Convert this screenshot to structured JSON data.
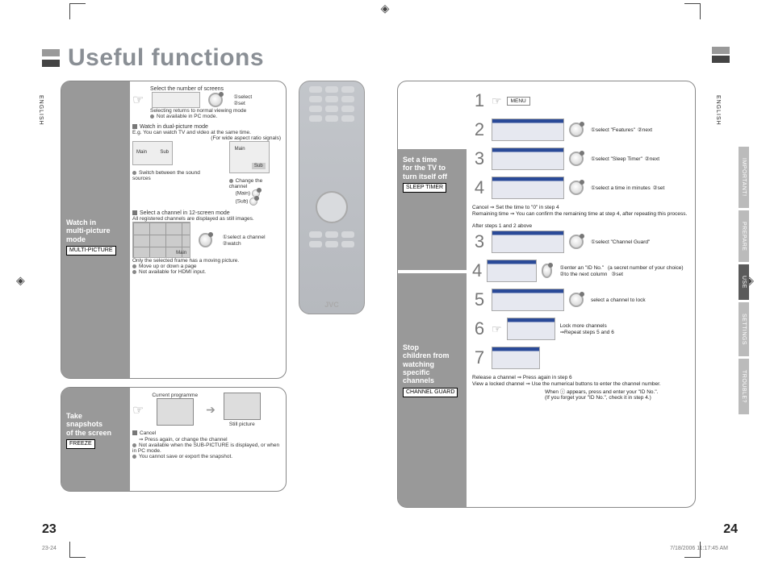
{
  "language_label": "ENGLISH",
  "page_title": "Useful functions",
  "side_tabs": [
    "IMPORTANT!",
    "PREPARE",
    "USE",
    "SETTINGS",
    "TROUBLE?"
  ],
  "side_tabs_active_index": 2,
  "left_page_number": "23",
  "right_page_number": "24",
  "footer_sheet": "23-24",
  "footer_timestamp": "7/18/2006   11:17:45 AM",
  "section_multi_picture": {
    "header_lines": [
      "Watch in",
      "multi-picture",
      "mode"
    ],
    "button_label": "MULTI-PICTURE",
    "select_screens_title": "Select the number of screens",
    "knob1_a": "①select",
    "knob1_b": "②set",
    "selecting_note": "Selecting          returns to normal viewing mode",
    "not_pc": "Not available in PC mode.",
    "dual_title": "Watch in dual-picture mode",
    "dual_eg": "E.g. You can watch TV and video at the same time.",
    "wide_note": "(For wide aspect ratio signals)",
    "box_main": "Main",
    "box_sub": "Sub",
    "switch_title": "Switch between the sound sources",
    "change_title": "Change the channel",
    "change_main": "(Main)",
    "change_sub": "(Sub)",
    "twelve_title": "Select a channel in 12-screen mode",
    "twelve_caption": "All registered channels are displayed as still images.",
    "twelve_knob_a": "①select a channel",
    "twelve_knob_b": "②watch",
    "twelve_note_frame": "Only the selected frame has a moving picture.",
    "twelve_note_page": "Move up or down a page",
    "twelve_note_hdmi": "Not available for HDMI input."
  },
  "section_freeze": {
    "header_lines": [
      "Take",
      "snapshots",
      "of the screen"
    ],
    "button_label": "FREEZE",
    "current_label": "Current programme",
    "still_label": "Still picture",
    "cancel_title": "Cancel",
    "cancel_body": "Press        again, or change the channel",
    "note_sub": "Not available when the SUB-PICTURE is displayed, or when in PC mode.",
    "note_save": "You cannot save or export the snapshot."
  },
  "section_sleep": {
    "header_lines": [
      "Set a time",
      "for the TV to",
      "turn itself off"
    ],
    "button_label": "SLEEP TIMER",
    "step1_icon": "MENU",
    "step2_a": "①select \"Features\"",
    "step2_b": "②next",
    "step3_a": "①select \"Sleep Timer\"",
    "step3_b": "②next",
    "step4_a": "①select a time in minutes",
    "step4_b": "②set",
    "cancel_line": "Cancel ⇒ Set the time to \"0\" in step 4",
    "remain_line_a": "Remaining time ⇒",
    "remain_line_b": "You can confirm the remaining time at step 4, after repeating this process."
  },
  "section_channel_guard": {
    "header_lines": [
      "Stop",
      "children from",
      "watching",
      "specific",
      "channels"
    ],
    "button_label": "CHANNEL GUARD",
    "after_note": "After steps 1 and 2 above",
    "step3_a": "①select \"Channel Guard\"",
    "step4_a": "①enter an \"ID No.\"",
    "step4_paren": "(a secret number of your choice)",
    "step4_b": "②to the next column",
    "step4_c": "③set",
    "step5_a": "select a channel to lock",
    "step6_a": "Lock more channels",
    "step6_b": "⇒Repeat steps 5 and 6",
    "release_a": "Release a channel ⇒",
    "release_b": "Press        again in step 6",
    "view_a": "View a locked channel ⇒",
    "view_b": "Use the numerical buttons to enter the channel number.",
    "view_c": "When ⓘ appears, press        and enter your \"ID No.\".",
    "view_d": "(If you forget your \"ID No.\", check it in step 4.)"
  },
  "remote_brand": "JVC"
}
